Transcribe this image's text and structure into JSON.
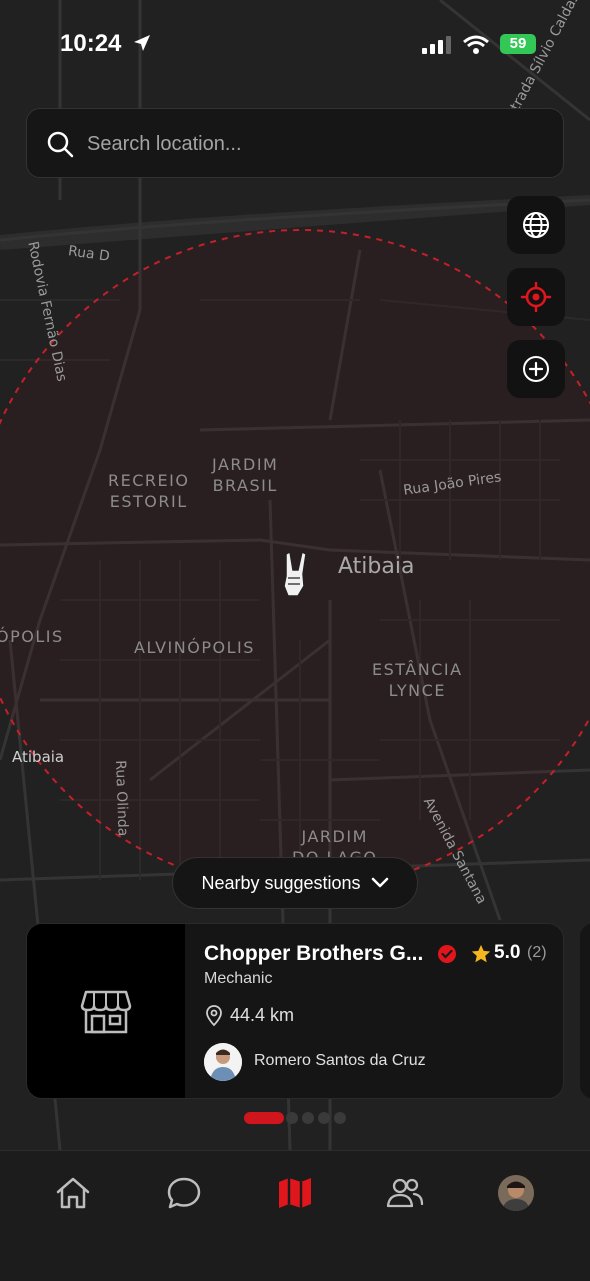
{
  "status_bar": {
    "time": "10:24",
    "battery": "59"
  },
  "search": {
    "placeholder": "Search location..."
  },
  "map": {
    "neighborhoods": [
      {
        "key": "recreio",
        "text": "RECREIO\nESTORIL"
      },
      {
        "key": "jardim_brasil",
        "text": "JARDIM\nBRASIL"
      },
      {
        "key": "alvinopolis",
        "text": "ALVINÓPOLIS"
      },
      {
        "key": "estancia_lynce",
        "text": "ESTÂNCIA\nLYNCE"
      },
      {
        "key": "jardim_do_lago",
        "text": "JARDIM\nDO LAGO"
      },
      {
        "key": "opolis_edge",
        "text": "ÓPOLIS"
      }
    ],
    "streets": {
      "rua_d": "Rua D",
      "fernao_dias": "Rodovia Fernão Dias",
      "rua_joao_pires": "Rua João Pires",
      "rua_olinda": "Rua Olinda",
      "avenida_santana": "Avenida Santana",
      "silvio_caldas": "Estrada Sílvio Caldas",
      "atibaia_left": "Atibaia"
    },
    "city": "Atibaia",
    "search_radius_color": "#d0202a"
  },
  "controls": [
    "globe-icon",
    "locate-icon",
    "add-icon"
  ],
  "nearby": {
    "label": "Nearby suggestions"
  },
  "card": {
    "name": "Chopper Brothers G...",
    "category": "Mechanic",
    "rating": "5.0",
    "review_count": "(2)",
    "distance": "44.4 km",
    "owner": "Romero Santos da Cruz",
    "verified_color": "#e0161c"
  },
  "pagination": {
    "count": 5,
    "active": 0
  },
  "tabs": [
    "home",
    "chat",
    "map",
    "community",
    "profile"
  ],
  "colors": {
    "accent": "#e0161c",
    "background": "#1b1b1b",
    "card": "#151515"
  }
}
